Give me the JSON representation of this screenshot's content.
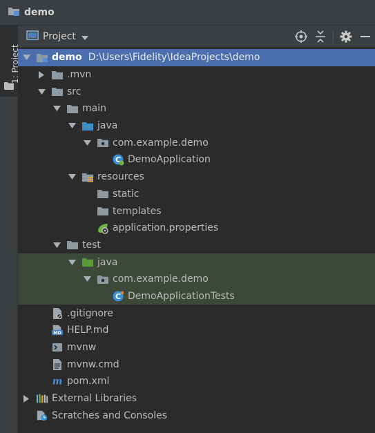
{
  "window": {
    "title": "demo"
  },
  "tool_strip": {
    "project_tab_label": "1: Project"
  },
  "panel": {
    "view_label": "Project"
  },
  "tree": [
    {
      "label": "demo",
      "path": "D:\\Users\\Fidelity\\IdeaProjects\\demo",
      "level": 0,
      "arrow": "down",
      "icon": "module-folder-icon",
      "selected": true,
      "bold": true
    },
    {
      "label": ".mvn",
      "level": 1,
      "arrow": "right",
      "icon": "folder-icon"
    },
    {
      "label": "src",
      "level": 1,
      "arrow": "down",
      "icon": "folder-icon"
    },
    {
      "label": "main",
      "level": 2,
      "arrow": "down",
      "icon": "folder-icon"
    },
    {
      "label": "java",
      "level": 3,
      "arrow": "down",
      "icon": "source-folder-icon"
    },
    {
      "label": "com.example.demo",
      "level": 4,
      "arrow": "down",
      "icon": "package-icon"
    },
    {
      "label": "DemoApplication",
      "level": 5,
      "arrow": "none",
      "icon": "spring-class-icon"
    },
    {
      "label": "resources",
      "level": 3,
      "arrow": "down",
      "icon": "resources-folder-icon"
    },
    {
      "label": "static",
      "level": 4,
      "arrow": "none",
      "icon": "folder-icon"
    },
    {
      "label": "templates",
      "level": 4,
      "arrow": "none",
      "icon": "folder-icon"
    },
    {
      "label": "application.properties",
      "level": 4,
      "arrow": "none",
      "icon": "spring-properties-icon"
    },
    {
      "label": "test",
      "level": 2,
      "arrow": "down",
      "icon": "folder-icon"
    },
    {
      "label": "java",
      "level": 3,
      "arrow": "down",
      "icon": "test-folder-icon",
      "test": true
    },
    {
      "label": "com.example.demo",
      "level": 4,
      "arrow": "down",
      "icon": "package-icon",
      "test": true
    },
    {
      "label": "DemoApplicationTests",
      "level": 5,
      "arrow": "none",
      "icon": "class-icon",
      "test": true
    },
    {
      "label": ".gitignore",
      "level": 1,
      "arrow": "none",
      "icon": "ignore-file-icon"
    },
    {
      "label": "HELP.md",
      "level": 1,
      "arrow": "none",
      "icon": "markdown-file-icon"
    },
    {
      "label": "mvnw",
      "level": 1,
      "arrow": "none",
      "icon": "script-file-icon"
    },
    {
      "label": "mvnw.cmd",
      "level": 1,
      "arrow": "none",
      "icon": "text-file-icon"
    },
    {
      "label": "pom.xml",
      "level": 1,
      "arrow": "none",
      "icon": "maven-icon"
    },
    {
      "label": "External Libraries",
      "level": 0,
      "arrow": "right",
      "icon": "libraries-icon"
    },
    {
      "label": "Scratches and Consoles",
      "level": 0,
      "arrow": "none",
      "icon": "scratches-icon"
    }
  ]
}
